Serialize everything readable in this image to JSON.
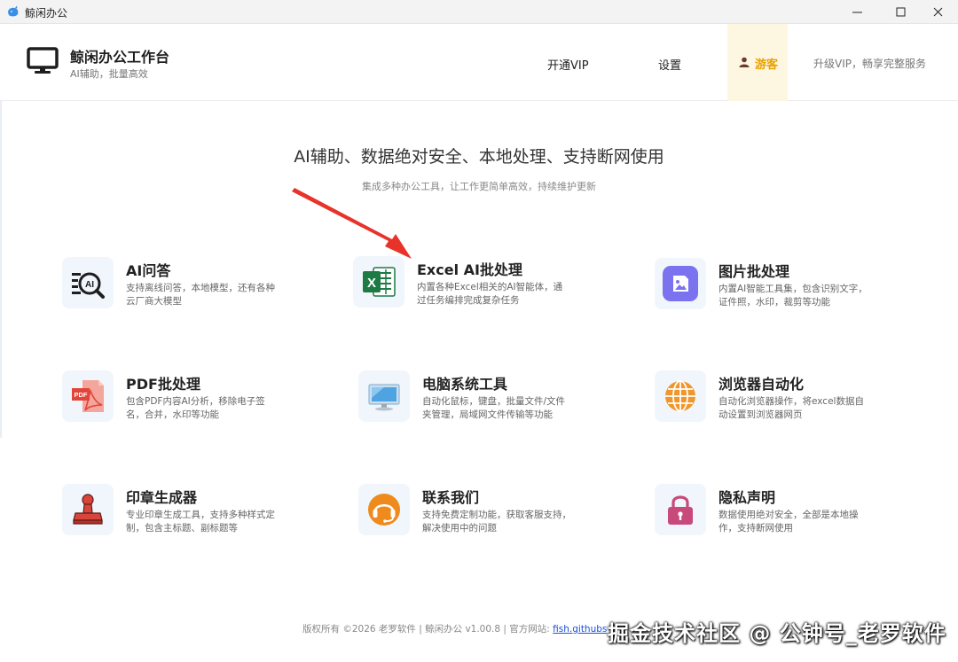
{
  "window": {
    "title": "鲸闲办公",
    "controls": [
      "minimize-icon",
      "maximize-icon",
      "close-icon"
    ]
  },
  "header": {
    "app_title": "鲸闲办公工作台",
    "app_subtitle": "AI辅助，批量高效",
    "nav_vip": "开通VIP",
    "nav_settings": "设置",
    "guest_label": "游客",
    "upgrade_text": "升级VIP，畅享完整服务"
  },
  "hero": {
    "title": "AI辅助、数据绝对安全、本地处理、支持断网使用",
    "subtitle": "集成多种办公工具，让工作更简单高效，持续维护更新"
  },
  "cards": [
    {
      "title": "AI问答",
      "desc": "支持离线问答，本地模型，还有各种云厂商大模型",
      "icon": "ai-chat-icon"
    },
    {
      "title": "Excel AI批处理",
      "desc": "内置各种Excel相关的AI智能体，通过任务编排完成复杂任务",
      "icon": "excel-icon"
    },
    {
      "title": "图片批处理",
      "desc": "内置AI智能工具集，包含识别文字，证件照，水印，裁剪等功能",
      "icon": "image-icon"
    },
    {
      "title": "PDF批处理",
      "desc": "包含PDF内容AI分析，移除电子签名，合并，水印等功能",
      "icon": "pdf-icon"
    },
    {
      "title": "电脑系统工具",
      "desc": "自动化鼠标，键盘，批量文件/文件夹管理，局域网文件传输等功能",
      "icon": "monitor-icon"
    },
    {
      "title": "浏览器自动化",
      "desc": "自动化浏览器操作，将excel数据自动设置到浏览器网页",
      "icon": "globe-icon"
    },
    {
      "title": "印章生成器",
      "desc": "专业印章生成工具，支持多种样式定制，包含主标题、副标题等",
      "icon": "stamp-icon"
    },
    {
      "title": "联系我们",
      "desc": "支持免费定制功能，获取客服支持，解决使用中的问题",
      "icon": "headset-icon"
    },
    {
      "title": "隐私声明",
      "desc": "数据使用绝对安全，全部是本地操作，支持断网使用",
      "icon": "lock-icon"
    }
  ],
  "footer": {
    "text": "版权所有 ©2026 老罗软件 | 鲸闲办公 v1.00.8 | 官方网站: ",
    "link": "fish.githubs",
    "watermark": "掘金技术社区 @ 公钟号_老罗软件"
  },
  "colors": {
    "accent": "#e8a100",
    "guest_bg": "#fdf6e0",
    "arrow": "#e8332a",
    "link": "#1a4fd6"
  }
}
